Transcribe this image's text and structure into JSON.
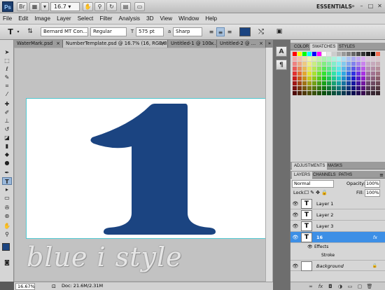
{
  "app": {
    "logo": "Ps",
    "zoom": "16.7",
    "workspace": "ESSENTIALS",
    "icons": [
      "bridge-icon",
      "mini-bridge-icon",
      "hand-icon",
      "zoom-icon",
      "rotate-icon",
      "arrange-icon",
      "screen-mode-icon"
    ]
  },
  "menu": [
    "File",
    "Edit",
    "Image",
    "Layer",
    "Select",
    "Filter",
    "Analysis",
    "3D",
    "View",
    "Window",
    "Help"
  ],
  "options": {
    "tool_glyph": "T",
    "font_family": "Bernard MT Con...",
    "font_style": "Regular",
    "font_size": "575 pt",
    "antialias": "Sharp",
    "color": "#1b4481"
  },
  "tabs": [
    {
      "label": "WaterMark.psd"
    },
    {
      "label": "NumberTemplate.psd @ 16.7% (16, RGB/8) *",
      "active": true
    },
    {
      "label": "Untitled-1 @ 100..."
    },
    {
      "label": "Untitled-2 @ ..."
    }
  ],
  "canvas": {
    "glyph": "1",
    "glyph_color": "#1b4481"
  },
  "status": {
    "zoom": "16.67%",
    "doc": "Doc: 21.6M/2.31M"
  },
  "panels": {
    "top_tabs": [
      "COLOR",
      "SWATCHES",
      "STYLES"
    ],
    "adj_tabs": [
      "ADJUSTMENTS",
      "MASKS"
    ],
    "layer_tabs": [
      "LAYERS",
      "CHANNELS",
      "PATHS"
    ],
    "blend_mode": "Normal",
    "opacity_label": "Opacity:",
    "opacity": "100%",
    "lock_label": "Lock:",
    "fill_label": "Fill:",
    "fill": "100%",
    "layers": [
      {
        "name": "Layer 1",
        "type": "T"
      },
      {
        "name": "Layer 2",
        "type": "T"
      },
      {
        "name": "Layer 3",
        "type": "T"
      },
      {
        "name": "16",
        "type": "T",
        "selected": true,
        "fx": "fx"
      }
    ],
    "effects_label": "Effects",
    "stroke_label": "Stroke",
    "background_label": "Background"
  },
  "watermark": "blue i style"
}
